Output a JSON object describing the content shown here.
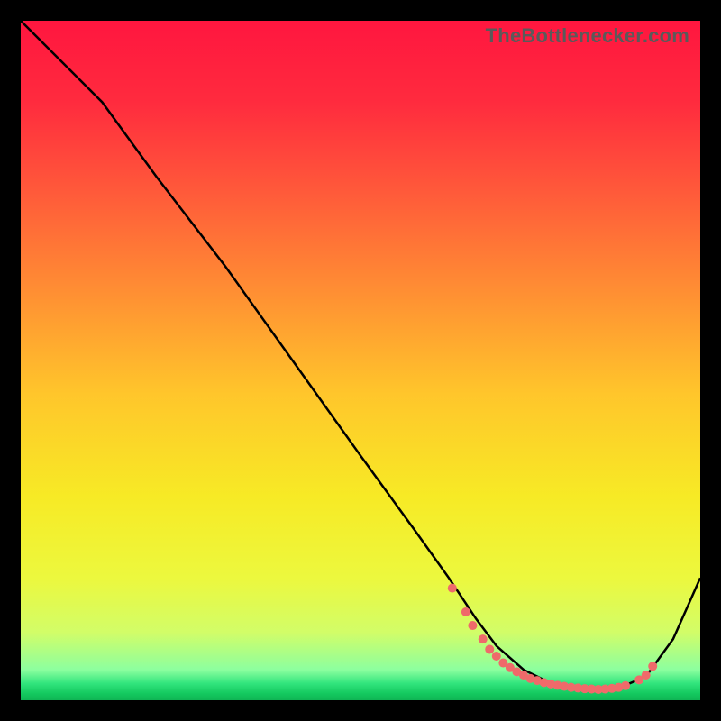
{
  "watermark": "TheBottlenecker.com",
  "chart_data": {
    "type": "line",
    "title": "",
    "xlabel": "",
    "ylabel": "",
    "xlim": [
      0,
      100
    ],
    "ylim": [
      0,
      100
    ],
    "grid": false,
    "background_gradient": {
      "type": "vertical",
      "stops": [
        {
          "pos": 0.0,
          "color": "#ff163f"
        },
        {
          "pos": 0.12,
          "color": "#ff2b3e"
        },
        {
          "pos": 0.25,
          "color": "#ff593a"
        },
        {
          "pos": 0.4,
          "color": "#ff8f33"
        },
        {
          "pos": 0.55,
          "color": "#ffc62b"
        },
        {
          "pos": 0.7,
          "color": "#f7ea25"
        },
        {
          "pos": 0.82,
          "color": "#ecf83e"
        },
        {
          "pos": 0.9,
          "color": "#d2fd68"
        },
        {
          "pos": 0.955,
          "color": "#8cff9f"
        },
        {
          "pos": 0.975,
          "color": "#32e57d"
        },
        {
          "pos": 0.99,
          "color": "#14c95f"
        },
        {
          "pos": 1.0,
          "color": "#0fb554"
        }
      ]
    },
    "series": [
      {
        "name": "curve",
        "color": "#000000",
        "x": [
          0,
          3,
          6,
          12,
          20,
          30,
          40,
          50,
          58,
          63,
          67,
          70,
          74,
          78,
          82,
          85,
          88,
          92,
          96,
          100
        ],
        "y": [
          100,
          97,
          94,
          88,
          77,
          64,
          50,
          36,
          25,
          18,
          12,
          8,
          4.5,
          2.5,
          1.8,
          1.6,
          1.8,
          3.5,
          9,
          18
        ]
      }
    ],
    "markers": {
      "name": "dots",
      "color": "#ef6a6a",
      "radius": 5,
      "points": [
        {
          "x": 63.5,
          "y": 16.5
        },
        {
          "x": 65.5,
          "y": 13
        },
        {
          "x": 66.5,
          "y": 11
        },
        {
          "x": 68,
          "y": 9
        },
        {
          "x": 69,
          "y": 7.5
        },
        {
          "x": 70,
          "y": 6.5
        },
        {
          "x": 71,
          "y": 5.5
        },
        {
          "x": 72,
          "y": 4.8
        },
        {
          "x": 73,
          "y": 4.2
        },
        {
          "x": 74,
          "y": 3.7
        },
        {
          "x": 75,
          "y": 3.2
        },
        {
          "x": 76,
          "y": 2.9
        },
        {
          "x": 77,
          "y": 2.6
        },
        {
          "x": 78,
          "y": 2.4
        },
        {
          "x": 79,
          "y": 2.2
        },
        {
          "x": 80,
          "y": 2.05
        },
        {
          "x": 81,
          "y": 1.9
        },
        {
          "x": 82,
          "y": 1.8
        },
        {
          "x": 83,
          "y": 1.7
        },
        {
          "x": 84,
          "y": 1.65
        },
        {
          "x": 85,
          "y": 1.6
        },
        {
          "x": 86,
          "y": 1.65
        },
        {
          "x": 87,
          "y": 1.75
        },
        {
          "x": 88,
          "y": 1.9
        },
        {
          "x": 89,
          "y": 2.15
        },
        {
          "x": 91,
          "y": 3.0
        },
        {
          "x": 92,
          "y": 3.7
        },
        {
          "x": 93,
          "y": 5.0
        }
      ]
    }
  }
}
